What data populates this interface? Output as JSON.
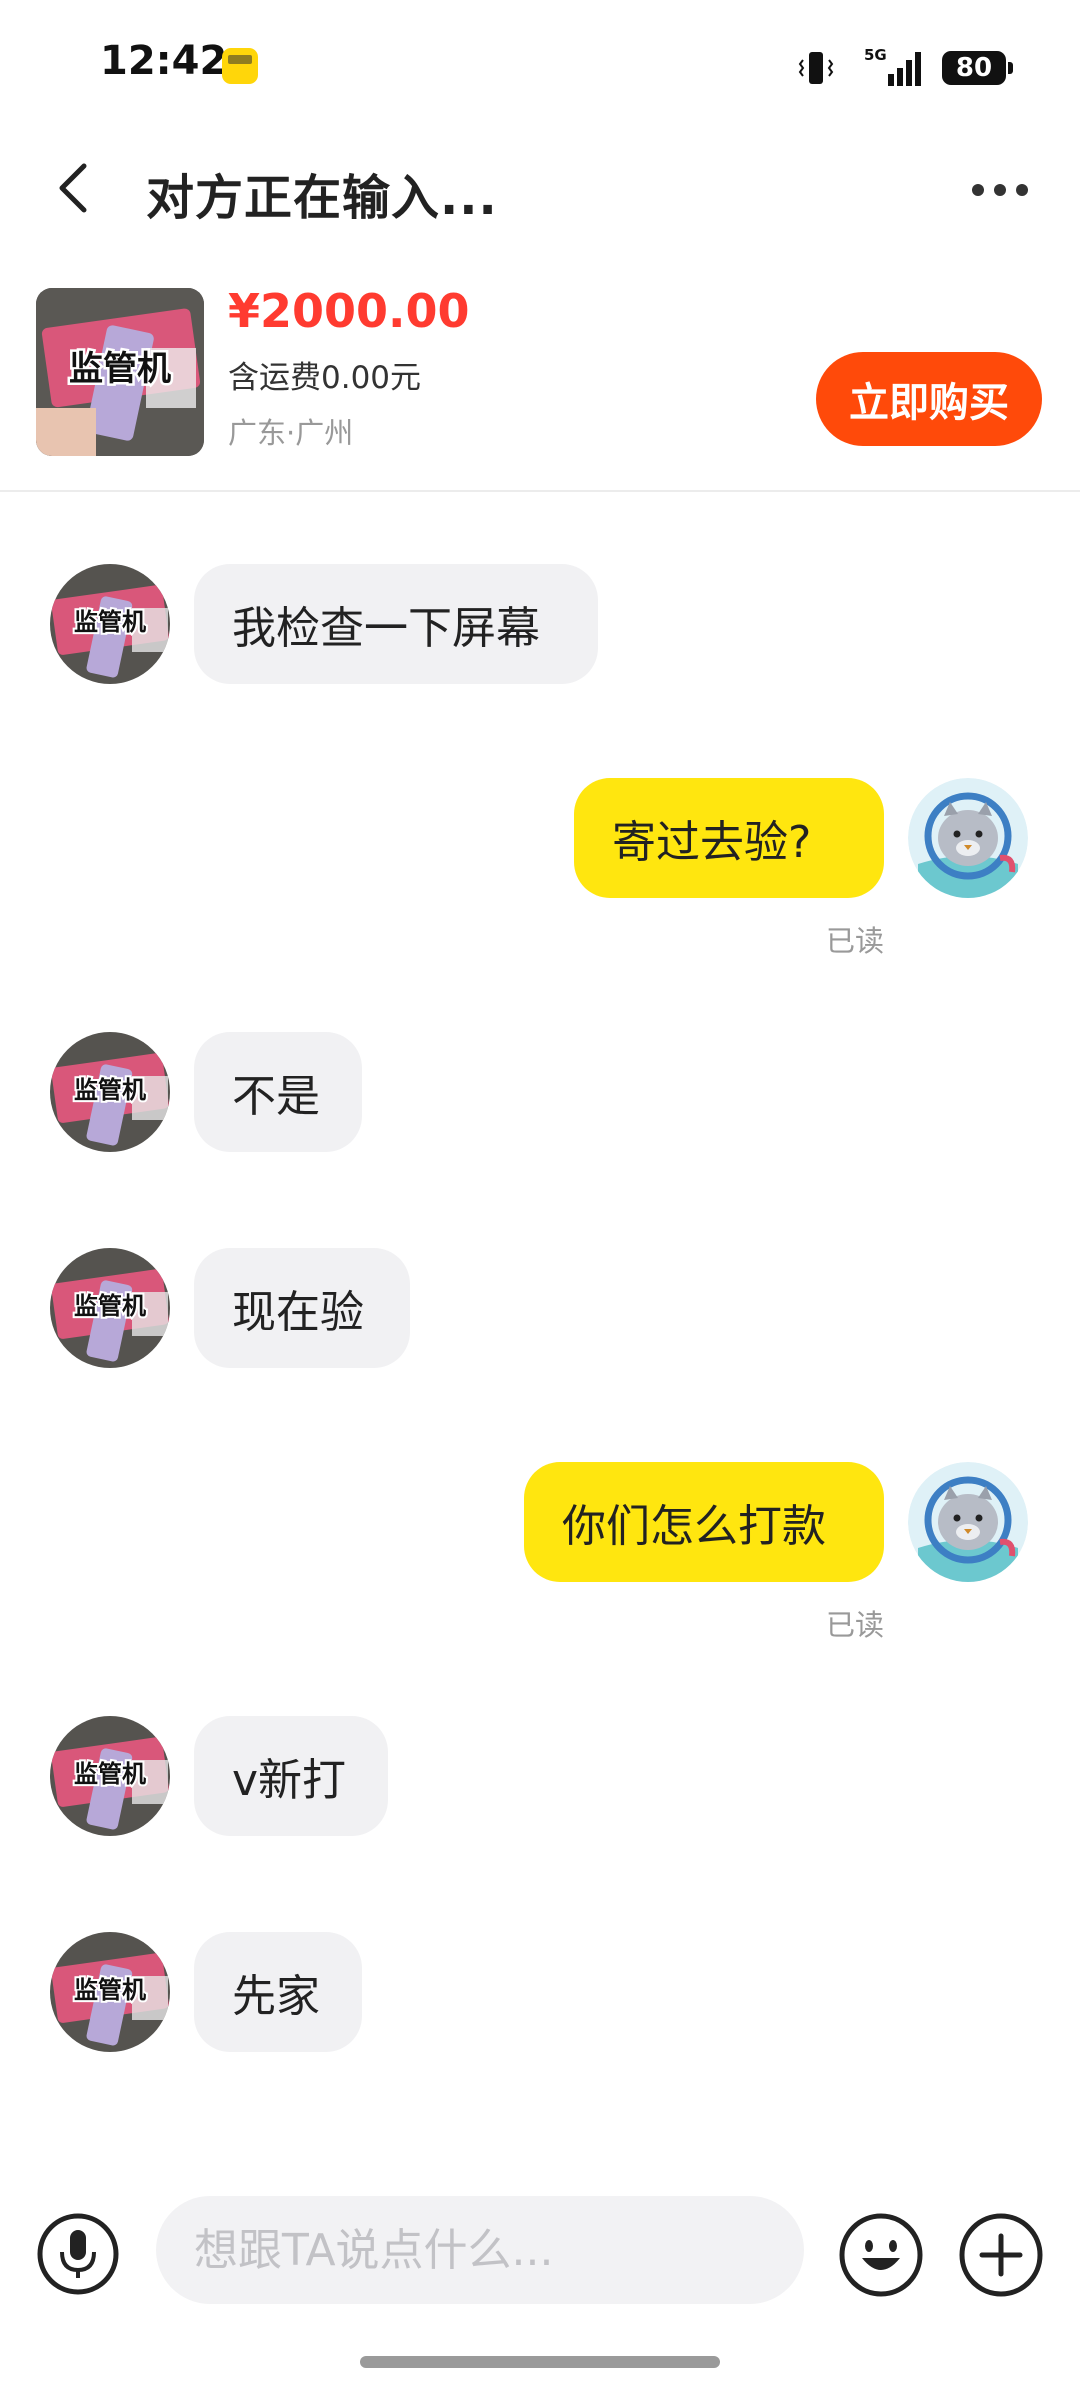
{
  "status_bar": {
    "time": "12:42",
    "network": "5G",
    "battery": "80"
  },
  "header": {
    "title": "对方正在输入..."
  },
  "product": {
    "price": "¥2000.00",
    "shipping": "含运费0.00元",
    "location": "广东·广州",
    "thumb_label": "监管机",
    "buy_label": "立即购买"
  },
  "avatar_label": "监管机",
  "messages": [
    {
      "side": "in",
      "text": "我检查一下屏幕"
    },
    {
      "side": "out",
      "text": "寄过去验?",
      "read": "已读"
    },
    {
      "side": "in",
      "text": "不是"
    },
    {
      "side": "in",
      "text": "现在验"
    },
    {
      "side": "out",
      "text": "你们怎么打款",
      "read": "已读"
    },
    {
      "side": "in",
      "text": "v新打"
    },
    {
      "side": "in",
      "text": "先家"
    }
  ],
  "input": {
    "placeholder": "想跟TA说点什么..."
  },
  "colors": {
    "accent": "#ff4a0a",
    "price": "#ff3b30",
    "bubble_out": "#ffe60f",
    "bubble_in": "#f1f1f3"
  }
}
